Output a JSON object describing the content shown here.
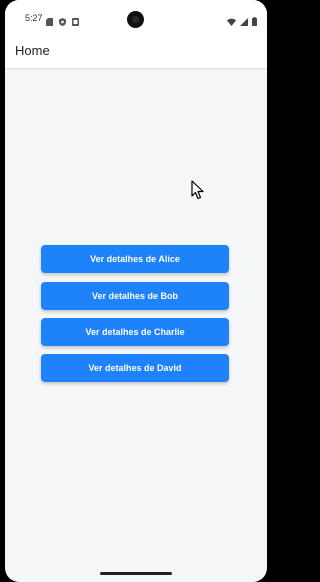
{
  "status_bar": {
    "time": "5:27",
    "left_icons": [
      "sd-card-icon",
      "shield-icon",
      "notification-icon"
    ],
    "right_icons": [
      "wifi-icon",
      "signal-icon",
      "battery-icon"
    ]
  },
  "app_bar": {
    "title": "Home"
  },
  "buttons": [
    {
      "label": "Ver detalhes de Alice"
    },
    {
      "label": "Ver detalhes de Bob"
    },
    {
      "label": "Ver detalhes de Charlie"
    },
    {
      "label": "Ver detalhes de David"
    }
  ],
  "colors": {
    "primary": "#1e82fa",
    "background": "#f5f6f8",
    "surface": "#ffffff"
  }
}
